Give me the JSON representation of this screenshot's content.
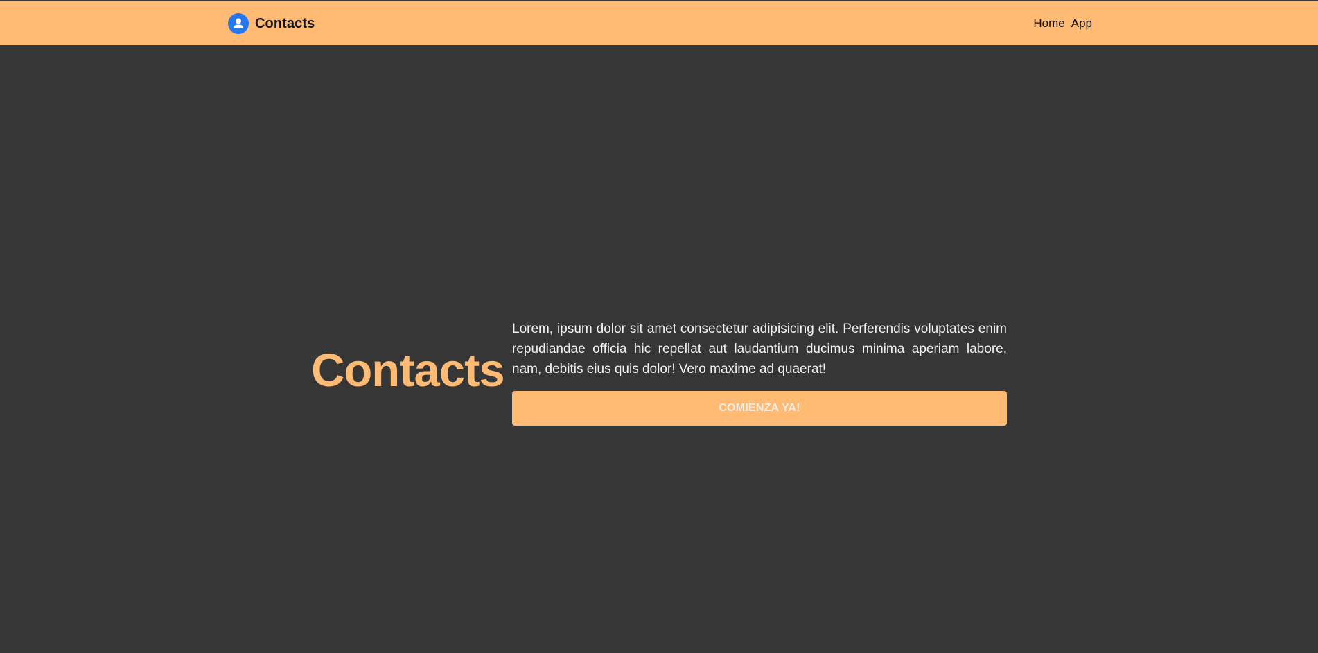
{
  "navbar": {
    "brand_icon": "user-circle-icon",
    "brand_title": "Contacts",
    "links": [
      {
        "label": "Home"
      },
      {
        "label": "App"
      }
    ]
  },
  "hero": {
    "title": "Contacts",
    "description": "Lorem, ipsum dolor sit amet consectetur adipisicing elit. Perferendis voluptates enim repudiandae officia hic repellat aut laudantium ducimus minima aperiam labore, nam, debitis eius quis dolor! Vero maxime ad quaerat!",
    "cta_label": "COMIENZA YA!"
  },
  "colors": {
    "accent": "#ffba73",
    "background": "#363636",
    "brand_icon": "#2377f0"
  }
}
